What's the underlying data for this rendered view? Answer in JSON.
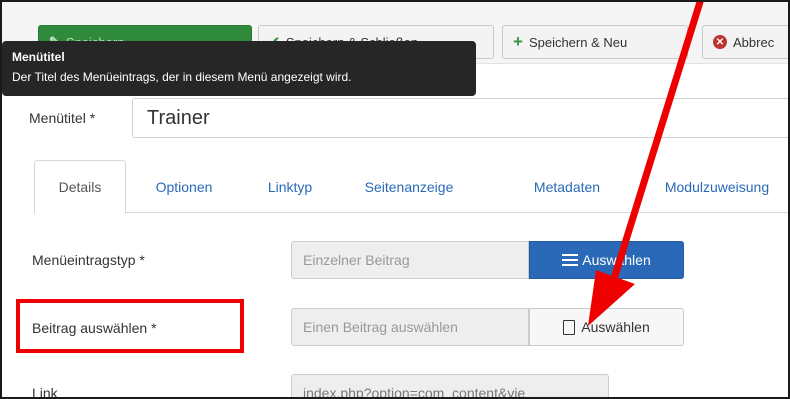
{
  "toolbar": {
    "save_label": "Speichern",
    "save_close_label": "Speichern & Schließen",
    "save_new_label": "Speichern & Neu",
    "cancel_label": "Abbrec"
  },
  "tooltip": {
    "title": "Menütitel",
    "text": "Der Titel des Menüeintrags, der in diesem Menü angezeigt wird."
  },
  "title_field": {
    "label": "Menütitel *",
    "value": "Trainer"
  },
  "tabs": [
    {
      "label": "Details",
      "active": true
    },
    {
      "label": "Optionen",
      "active": false
    },
    {
      "label": "Linktyp",
      "active": false
    },
    {
      "label": "Seitenanzeige",
      "active": false
    },
    {
      "label": "Metadaten",
      "active": false
    },
    {
      "label": "Modulzuweisung",
      "active": false
    }
  ],
  "menu_item_type": {
    "label": "Menüeintragstyp *",
    "value": "Einzelner Beitrag",
    "button_label": "Auswählen",
    "button_icon": "list-icon"
  },
  "select_article": {
    "label": "Beitrag auswählen *",
    "placeholder": "Einen Beitrag auswählen",
    "button_label": "Auswählen",
    "button_icon": "file-icon"
  },
  "link": {
    "label": "Link",
    "value": "index.php?option=com_content&vie"
  },
  "colors": {
    "annotation_red": "#ee0000",
    "primary_blue": "#2a69b8",
    "save_green": "#2f8a3b",
    "tooltip_bg": "#262626"
  }
}
